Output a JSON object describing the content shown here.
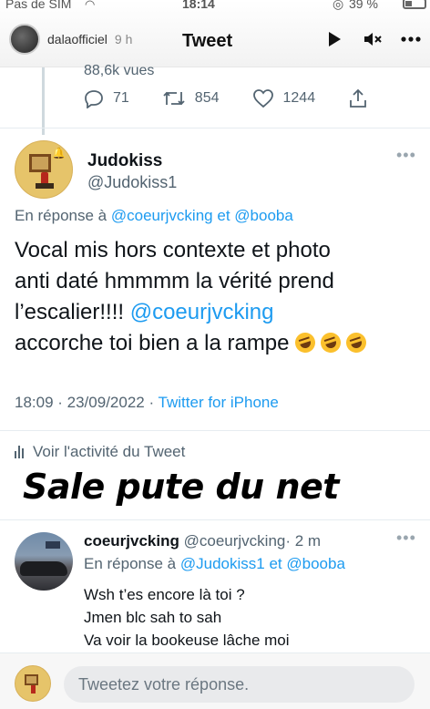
{
  "status_bar": {
    "carrier": "Pas de SIM",
    "time": "18:14",
    "battery": "39 %"
  },
  "story": {
    "username": "dalaofficiel",
    "ago": "9 h",
    "title": "Tweet",
    "icons": [
      "play-icon",
      "mute-icon",
      "more-icon"
    ]
  },
  "previous_tweet": {
    "views": "88,6k vues",
    "replies": "71",
    "retweets": "854",
    "likes": "1244"
  },
  "main_tweet": {
    "name": "Judokiss",
    "handle": "@Judokiss1",
    "reply_prefix": "En réponse à",
    "reply_user1": "@coeurjvcking",
    "reply_and": "et",
    "reply_user2": "@booba",
    "line1": "Vocal mis hors contexte et photo",
    "line2": "anti daté hmmmm la vérité prend",
    "line3": "l’escalier!!!!",
    "mention": "@coeurjvcking",
    "line4": "accorche toi bien a la rampe",
    "time": "18:09 · 23/09/2022 ·",
    "source": "Twitter for iPhone",
    "activity": "Voir l'activité du Tweet"
  },
  "overlay_caption": "Sale pute du net",
  "reply_tweet": {
    "name": "coeurjvcking",
    "handle": "@coeurjvcking",
    "time": "· 2 m",
    "reply_prefix": "En réponse à",
    "reply_user1": "@Judokiss1",
    "reply_and": "et",
    "reply_user2": "@booba",
    "line1": "Wsh t’es encore là toi ?",
    "line2": "Jmen blc sah to sah",
    "line3": "Va voir la bookeuse lâche moi"
  },
  "compose": {
    "placeholder": "Tweetez votre réponse."
  },
  "colors": {
    "link": "#1d9bf0",
    "secondary_text": "#536471",
    "primary_text": "#0f1419"
  }
}
